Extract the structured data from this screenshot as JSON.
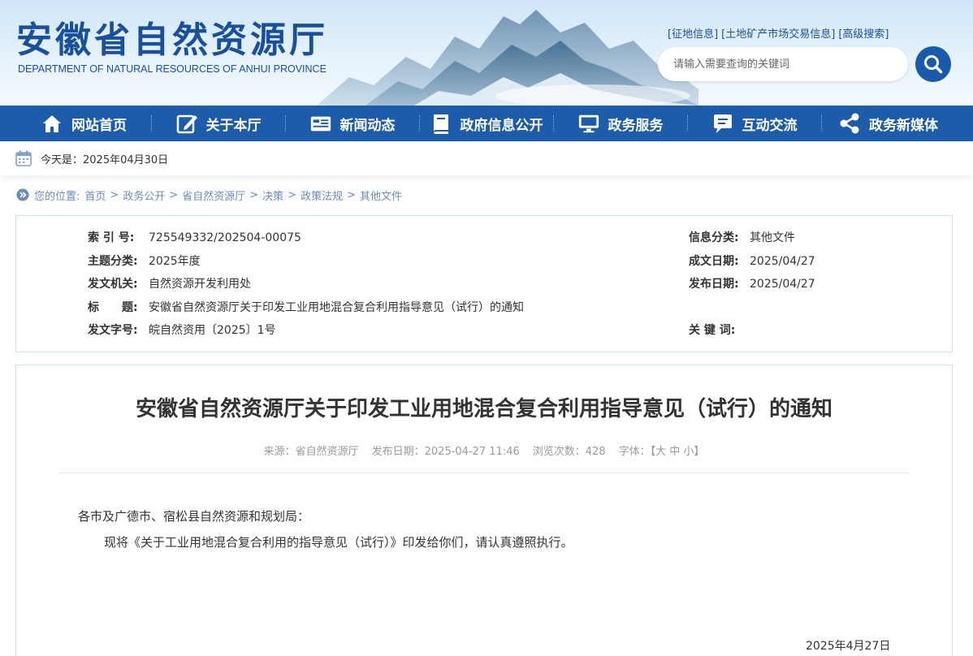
{
  "header": {
    "site_title": "安徽省自然资源厅",
    "site_subtitle": "DEPARTMENT OF NATURAL RESOURCES OF ANHUI PROVINCE",
    "quick_links": [
      "[征地信息]",
      "[土地矿产市场交易信息]",
      "[高级搜索]"
    ],
    "search_placeholder": "请输入需要查询的关键词",
    "search_icon": "search-icon"
  },
  "nav": {
    "items": [
      {
        "label": "网站首页",
        "icon": "home-icon"
      },
      {
        "label": "关于本厅",
        "icon": "edit-icon"
      },
      {
        "label": "新闻动态",
        "icon": "news-icon"
      },
      {
        "label": "政府信息公开",
        "icon": "book-icon"
      },
      {
        "label": "政务服务",
        "icon": "monitor-icon"
      },
      {
        "label": "互动交流",
        "icon": "chat-icon"
      },
      {
        "label": "政务新媒体",
        "icon": "share-icon"
      }
    ]
  },
  "datebar": {
    "text": "今天是：2025年04月30日"
  },
  "breadcrumb": {
    "prefix": "您的位置:",
    "items": [
      "首页",
      "政务公开",
      "省自然资源厅",
      "决策",
      "政策法规",
      "其他文件"
    ],
    "separator": ">"
  },
  "meta": {
    "index_no_label": "索 引 号:",
    "index_no": "725549332/202504-00075",
    "topic_label": "主题分类:",
    "topic": "2025年度",
    "issuer_label": "发文机关:",
    "issuer": "自然资源开发利用处",
    "title_label": "标　　题:",
    "title": "安徽省自然资源厅关于印发工业用地混合复合利用指导意见（试行）的通知",
    "doc_no_label": "发文字号:",
    "doc_no": "皖自然资用〔2025〕1号",
    "info_cat_label": "信息分类:",
    "info_cat": "其他文件",
    "written_label": "成文日期:",
    "written": "2025/04/27",
    "published_label": "发布日期:",
    "published": "2025/04/27",
    "keywords_label": "关 键 词:",
    "keywords": ""
  },
  "article": {
    "title": "安徽省自然资源厅关于印发工业用地混合复合利用指导意见（试行）的通知",
    "source": "来源：省自然资源厅",
    "pub_date": "发布日期：2025-04-27 11:46",
    "views": "浏览次数：428",
    "font_label": "字体：",
    "font_sizes": "【大 中 小】",
    "para1": "各市及广德市、宿松县自然资源和规划局：",
    "para2": "现将《关于工业用地混合复合利用的指导意见（试行）》印发给你们，请认真遵照执行。",
    "sign_date": "2025年4月27日"
  },
  "colors": {
    "primary": "#1c5cab",
    "title_blue": "#1a4f9c",
    "breadcrumb": "#6b8cb8",
    "border": "#d3e2f1"
  }
}
